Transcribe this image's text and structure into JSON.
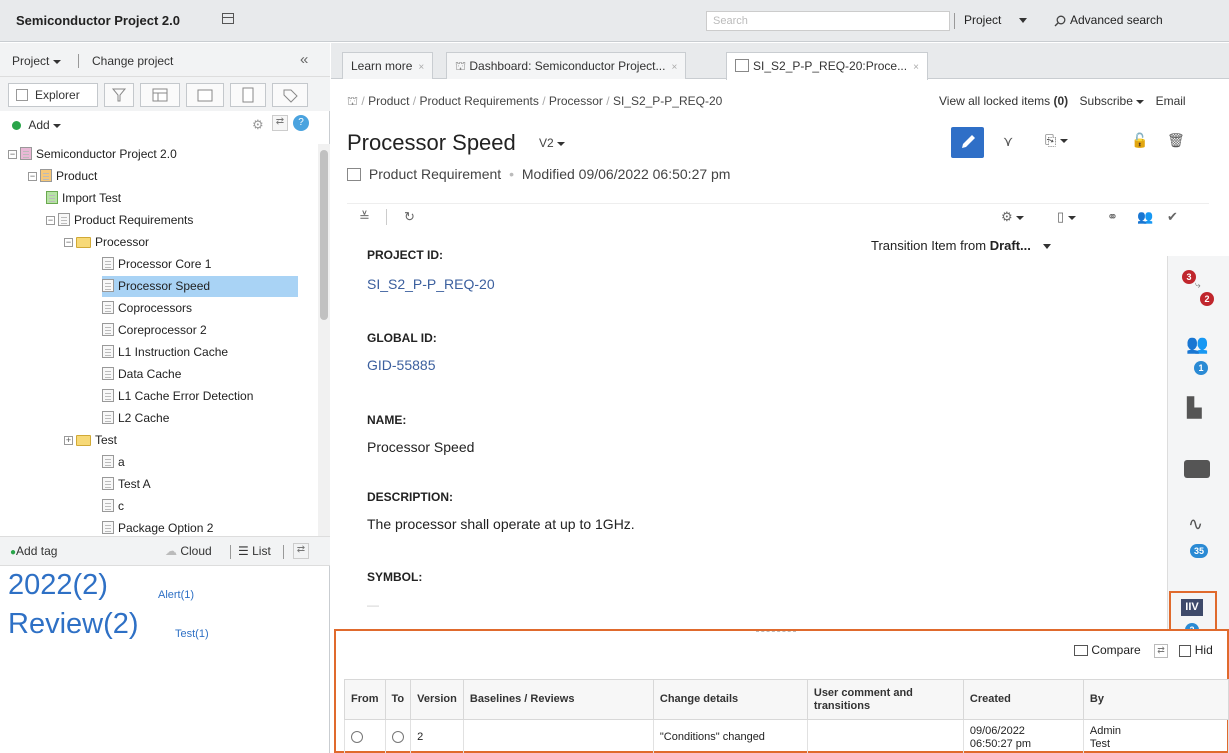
{
  "app": {
    "title": "Semiconductor Project 2.0"
  },
  "search": {
    "placeholder": "Search"
  },
  "header": {
    "project_label": "Project",
    "advanced_search": "Advanced search"
  },
  "left_panel": {
    "project_menu": "Project",
    "change_project": "Change project",
    "explorer_tab": "Explorer",
    "add_label": "Add",
    "tree": [
      {
        "label": "Semiconductor Project 2.0",
        "level": 0,
        "kind": "project",
        "expanded": true
      },
      {
        "label": "Product",
        "level": 1,
        "kind": "product",
        "expanded": true
      },
      {
        "label": "Import Test",
        "level": 2,
        "kind": "import"
      },
      {
        "label": "Product Requirements",
        "level": 2,
        "kind": "doc",
        "expanded": true
      },
      {
        "label": "Processor",
        "level": 3,
        "kind": "folder",
        "expanded": true
      },
      {
        "label": "Processor Core 1",
        "level": 4,
        "kind": "item"
      },
      {
        "label": "Processor Speed",
        "level": 4,
        "kind": "item",
        "selected": true
      },
      {
        "label": "Coprocessors",
        "level": 4,
        "kind": "item"
      },
      {
        "label": "Coreprocessor 2",
        "level": 4,
        "kind": "item"
      },
      {
        "label": "L1 Instruction Cache",
        "level": 4,
        "kind": "item"
      },
      {
        "label": "Data Cache",
        "level": 4,
        "kind": "item"
      },
      {
        "label": "L1 Cache Error Detection",
        "level": 4,
        "kind": "item"
      },
      {
        "label": "L2 Cache",
        "level": 4,
        "kind": "item"
      },
      {
        "label": "Test",
        "level": 3,
        "kind": "folder",
        "expanded": false
      },
      {
        "label": "a",
        "level": 4,
        "kind": "item"
      },
      {
        "label": "Test A",
        "level": 4,
        "kind": "item"
      },
      {
        "label": "c",
        "level": 4,
        "kind": "item"
      },
      {
        "label": "Package Option 2",
        "level": 4,
        "kind": "item"
      }
    ],
    "tags": {
      "add_tag": "Add tag",
      "cloud": "Cloud",
      "list": "List",
      "year_tag": "2022(2)",
      "alert_tag": "Alert(1)",
      "review_tag": "Review(2)",
      "test_tag": "Test(1)"
    }
  },
  "tabs": [
    {
      "label": "Learn more",
      "active": false
    },
    {
      "label": "Dashboard: Semiconductor Project...",
      "active": false
    },
    {
      "label": "SI_S2_P-P_REQ-20:Proce...",
      "active": true
    }
  ],
  "breadcrumb": [
    "Product",
    "Product Requirements",
    "Processor",
    "SI_S2_P-P_REQ-20"
  ],
  "top_links": {
    "locked_prefix": "View all locked items",
    "locked_count": "(0)",
    "subscribe": "Subscribe",
    "email": "Email"
  },
  "item": {
    "title": "Processor Speed",
    "version": "V2",
    "type": "Product Requirement",
    "modified": "Modified 09/06/2022 06:50:27 pm",
    "transition_prefix": "Transition Item from ",
    "transition_state": "Draft...",
    "fields": {
      "project_id_label": "PROJECT ID:",
      "project_id_value": "SI_S2_P-P_REQ-20",
      "global_id_label": "GLOBAL ID:",
      "global_id_value": "GID-55885",
      "name_label": "NAME:",
      "name_value": "Processor Speed",
      "description_label": "DESCRIPTION:",
      "description_value": "The processor shall operate at up to 1GHz.",
      "symbol_label": "SYMBOL:",
      "symbol_value": "—"
    }
  },
  "side_badges": {
    "relations": "3",
    "relations2": "2",
    "reviews": "1",
    "activity": "35",
    "versions": "2"
  },
  "history": {
    "compare": "Compare",
    "hide": "Hid",
    "columns": [
      "From",
      "To",
      "Version",
      "Baselines / Reviews",
      "Change details",
      "User comment and transitions",
      "Created",
      "By"
    ],
    "rows": [
      {
        "version": "2",
        "baselines": "",
        "change": "\"Conditions\" changed",
        "comment": "",
        "created_date": "09/06/2022",
        "created_time": "06:50:27 pm",
        "by_first": "Admin",
        "by_last": "Test"
      }
    ]
  },
  "colors": {
    "accent": "#2f6fc7",
    "link": "#3b5f9e",
    "selection": "#a9d3f5",
    "highlight_border": "#e06a2d"
  }
}
